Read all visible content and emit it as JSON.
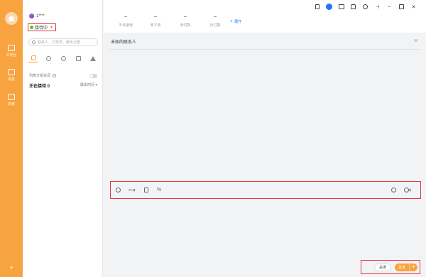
{
  "rail": {
    "items": [
      {
        "label": "工作台",
        "icon": "workbench-icon"
      },
      {
        "label": "消息",
        "icon": "message-icon"
      },
      {
        "label": "商家",
        "icon": "shop-icon"
      }
    ],
    "menu_icon": "menu-icon"
  },
  "user": {
    "name": "1****",
    "status": "接待中"
  },
  "search": {
    "placeholder": "联系人、订单号、聊天记录"
  },
  "contact_tabs": [
    "chat-icon",
    "clock-icon",
    "person-icon",
    "person-outline-icon",
    "team-icon"
  ],
  "group": {
    "label": "列表分组关闭",
    "serving_label": "正在接待 0",
    "sort_label": "联系时间"
  },
  "stats": [
    {
      "value": "–",
      "label": "今日接待"
    },
    {
      "value": "–",
      "label": "未下单"
    },
    {
      "value": "–",
      "label": "未付款"
    },
    {
      "value": "–",
      "label": "已付款"
    }
  ],
  "expand_label": "展开",
  "window_icons": [
    "phone-icon",
    "chat-bubble-icon",
    "image-icon",
    "shirt-icon",
    "play-icon",
    "pin-icon",
    "minimize-icon",
    "maximize-icon",
    "close-icon"
  ],
  "chat": {
    "header": "未知的联系人",
    "close_button": "关闭",
    "send_button": "发送"
  },
  "toolbar_icons": [
    "emoji-icon",
    "scissors-icon",
    "document-icon",
    "discount-icon"
  ],
  "toolbar_right_icons": [
    "history-icon",
    "more-icon"
  ],
  "colors": {
    "accent": "#f7a340",
    "highlight_border": "#e0393e",
    "online": "#52c41a",
    "link": "#1677ff"
  }
}
